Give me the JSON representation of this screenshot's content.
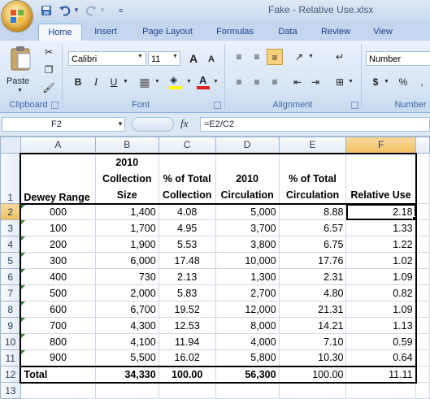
{
  "window": {
    "title": "Fake - Relative Use.xlsx"
  },
  "tabs": [
    "Home",
    "Insert",
    "Page Layout",
    "Formulas",
    "Data",
    "Review",
    "View"
  ],
  "active_tab": "Home",
  "ribbon": {
    "paste_label": "Paste",
    "font_name": "Calibri",
    "font_size": "11",
    "number_format": "Number",
    "groups": {
      "clipboard": "Clipboard",
      "font": "Font",
      "alignment": "Alignment",
      "number": "Number"
    },
    "bold": "B",
    "italic": "I",
    "underline": "U",
    "grow": "A",
    "shrink": "A",
    "font_color": "A",
    "currency": "$",
    "percent": "%"
  },
  "formula_bar": {
    "name_box": "F2",
    "fx": "fx",
    "formula": "=E2/C2"
  },
  "columns": [
    "A",
    "B",
    "C",
    "D",
    "E",
    "F"
  ],
  "selected_column": "F",
  "header_row": {
    "row_num": "1",
    "a": [
      "Dewey Range"
    ],
    "b": [
      "2010",
      "Collection",
      "Size"
    ],
    "c": [
      "% of Total",
      "Collection"
    ],
    "d": [
      "2010",
      "Circulation"
    ],
    "e": [
      "% of Total",
      "Circulation"
    ],
    "f": [
      "Relative Use"
    ]
  },
  "rows": [
    {
      "n": "2",
      "a": "000",
      "b": "1,400",
      "c": "4.08",
      "d": "5,000",
      "e": "8.88",
      "f": "2.18"
    },
    {
      "n": "3",
      "a": "100",
      "b": "1,700",
      "c": "4.95",
      "d": "3,700",
      "e": "6.57",
      "f": "1.33"
    },
    {
      "n": "4",
      "a": "200",
      "b": "1,900",
      "c": "5.53",
      "d": "3,800",
      "e": "6.75",
      "f": "1.22"
    },
    {
      "n": "5",
      "a": "300",
      "b": "6,000",
      "c": "17.48",
      "d": "10,000",
      "e": "17.76",
      "f": "1.02"
    },
    {
      "n": "6",
      "a": "400",
      "b": "730",
      "c": "2.13",
      "d": "1,300",
      "e": "2.31",
      "f": "1.09"
    },
    {
      "n": "7",
      "a": "500",
      "b": "2,000",
      "c": "5.83",
      "d": "2,700",
      "e": "4.80",
      "f": "0.82"
    },
    {
      "n": "8",
      "a": "600",
      "b": "6,700",
      "c": "19.52",
      "d": "12,000",
      "e": "21.31",
      "f": "1.09"
    },
    {
      "n": "9",
      "a": "700",
      "b": "4,300",
      "c": "12.53",
      "d": "8,000",
      "e": "14.21",
      "f": "1.13"
    },
    {
      "n": "10",
      "a": "800",
      "b": "4,100",
      "c": "11.94",
      "d": "4,000",
      "e": "7.10",
      "f": "0.59"
    },
    {
      "n": "11",
      "a": "900",
      "b": "5,500",
      "c": "16.02",
      "d": "5,800",
      "e": "10.30",
      "f": "0.64"
    }
  ],
  "total_row": {
    "n": "12",
    "a": "Total",
    "b": "34,330",
    "c": "100.00",
    "d": "56,300",
    "e": "100.00",
    "f": "11.11"
  },
  "extra_row": {
    "n": "13"
  },
  "selected_cell": "F2",
  "colors": {
    "selection": "#f1c15f",
    "ribbon": "#dae7f6",
    "tab_text": "#15428b"
  }
}
